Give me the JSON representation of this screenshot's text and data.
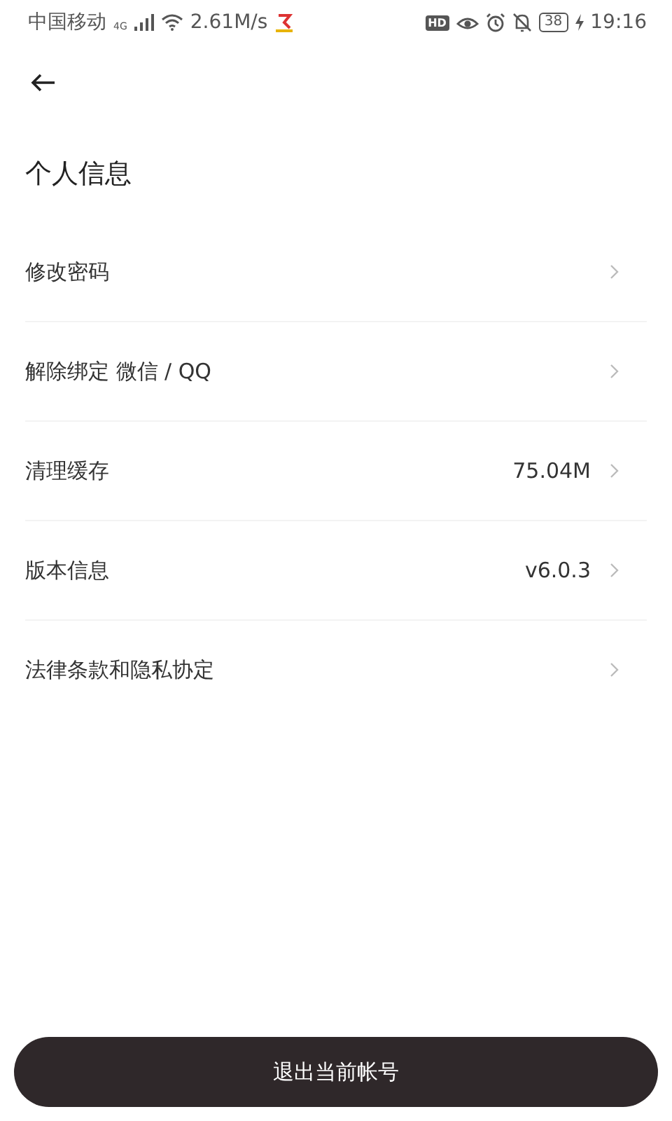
{
  "status_bar": {
    "carrier": "中国移动",
    "network": "4G",
    "speed": "2.61M/s",
    "hd": "HD",
    "battery": "38",
    "time": "19:16"
  },
  "title": "个人信息",
  "items": [
    {
      "label": "修改密码"
    },
    {
      "label": "解除绑定 微信 / QQ"
    },
    {
      "label": "清理缓存",
      "value": "75.04M"
    },
    {
      "label": "版本信息",
      "value": "v6.0.3"
    },
    {
      "label": "法律条款和隐私协定"
    }
  ],
  "logout_button": "退出当前帐号"
}
